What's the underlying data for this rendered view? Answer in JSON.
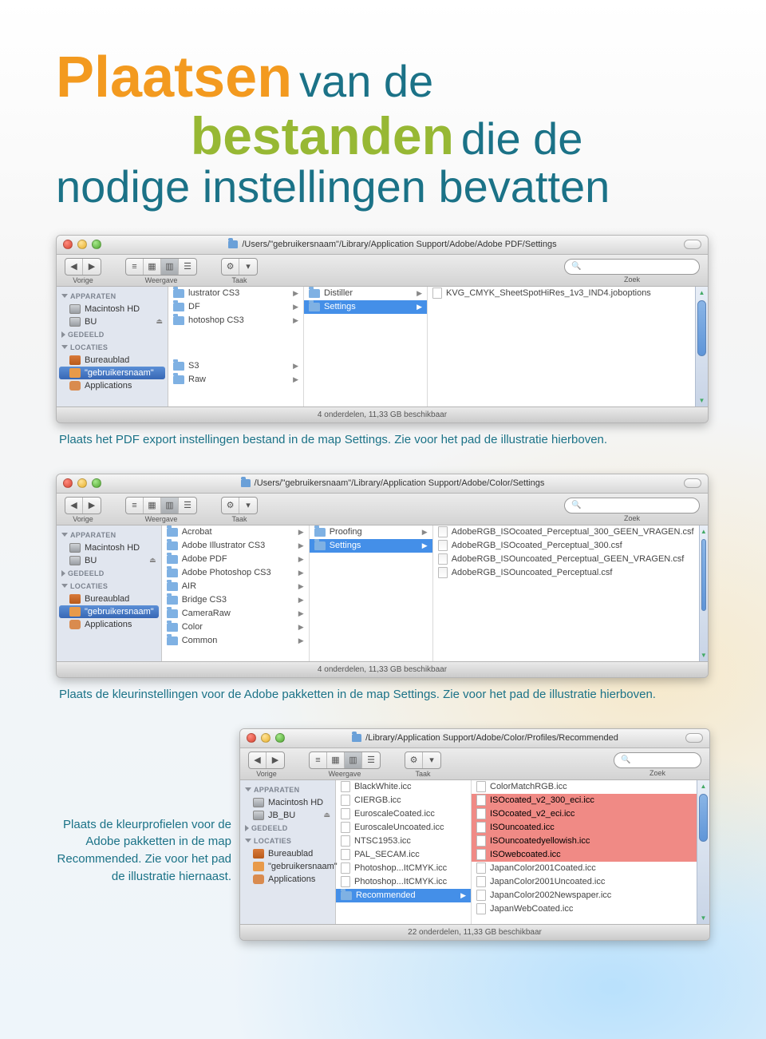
{
  "title": {
    "w1": "Plaatsen",
    "w2": "van de",
    "w3": "bestanden",
    "w4": "die de",
    "w5": "nodige instellingen bevatten"
  },
  "captions": {
    "c1": "Plaats het PDF export instellingen bestand in de map Settings. Zie voor het pad de illustratie hierboven.",
    "c2": "Plaats de kleurinstellingen voor de Adobe pakketten in de map Settings. Zie voor het pad de illustratie hierboven.",
    "c3": "Plaats de kleurprofielen voor de Adobe pakketten in de map Recommended. Zie voor het pad de illustratie hiernaast."
  },
  "finder1": {
    "path": "/Users/\"gebruikersnaam\"/Library/Application Support/Adobe/Adobe PDF/Settings",
    "tb": {
      "back": "Vorige",
      "view": "Weergave",
      "task": "Taak",
      "search": "Zoek"
    },
    "sidebar": {
      "h1": "APPARATEN",
      "h2": "GEDEELD",
      "h3": "LOCATIES",
      "items": [
        "Macintosh HD",
        "BU"
      ],
      "loc": [
        "Bureaublad",
        "\"gebruikersnaam\"",
        "Applications"
      ]
    },
    "col1": [
      "lustrator CS3",
      "DF",
      "hotoshop CS3",
      "S3",
      "Raw"
    ],
    "col2": [
      "Distiller",
      "Settings"
    ],
    "col3": [
      "KVG_CMYK_SheetSpotHiRes_1v3_IND4.joboptions"
    ],
    "status": "4 onderdelen, 11,33 GB beschikbaar"
  },
  "finder2": {
    "path": "/Users/\"gebruikersnaam\"/Library/Application Support/Adobe/Color/Settings",
    "tb": {
      "back": "Vorige",
      "view": "Weergave",
      "task": "Taak",
      "search": "Zoek"
    },
    "sidebar": {
      "h1": "APPARATEN",
      "h2": "GEDEELD",
      "h3": "LOCATIES",
      "items": [
        "Macintosh HD",
        "BU"
      ],
      "loc": [
        "Bureaublad",
        "\"gebruikersnaam\"",
        "Applications"
      ]
    },
    "col1": [
      "Acrobat",
      "Adobe Illustrator CS3",
      "Adobe PDF",
      "Adobe Photoshop CS3",
      "AIR",
      "Bridge CS3",
      "CameraRaw",
      "Color",
      "Common"
    ],
    "col2": [
      "Proofing",
      "Settings"
    ],
    "col3": [
      "AdobeRGB_ISOcoated_Perceptual_300_GEEN_VRAGEN.csf",
      "AdobeRGB_ISOcoated_Perceptual_300.csf",
      "AdobeRGB_ISOuncoated_Perceptual_GEEN_VRAGEN.csf",
      "AdobeRGB_ISOuncoated_Perceptual.csf"
    ],
    "status": "4 onderdelen, 11,33 GB beschikbaar"
  },
  "finder3": {
    "path": "/Library/Application Support/Adobe/Color/Profiles/Recommended",
    "tb": {
      "back": "Vorige",
      "view": "Weergave",
      "task": "Taak",
      "search": "Zoek"
    },
    "sidebar": {
      "h1": "APPARATEN",
      "h2": "GEDEELD",
      "h3": "LOCATIES",
      "items": [
        "Macintosh HD",
        "JB_BU"
      ],
      "loc": [
        "Bureaublad",
        "\"gebruikersnaam\"",
        "Applications"
      ]
    },
    "col1": [
      "BlackWhite.icc",
      "CIERGB.icc",
      "EuroscaleCoated.icc",
      "EuroscaleUncoated.icc",
      "NTSC1953.icc",
      "PAL_SECAM.icc",
      "Photoshop...ItCMYK.icc",
      "Photoshop...ItCMYK.icc",
      "Recommended"
    ],
    "col2": [
      "ColorMatchRGB.icc",
      "ISOcoated_v2_300_eci.icc",
      "ISOcoated_v2_eci.icc",
      "ISOuncoated.icc",
      "ISOuncoatedyellowish.icc",
      "ISOwebcoated.icc",
      "JapanColor2001Coated.icc",
      "JapanColor2001Uncoated.icc",
      "JapanColor2002Newspaper.icc",
      "JapanWebCoated.icc"
    ],
    "col2_red": [
      1,
      2,
      3,
      4,
      5
    ],
    "status": "22 onderdelen, 11,33 GB beschikbaar"
  }
}
